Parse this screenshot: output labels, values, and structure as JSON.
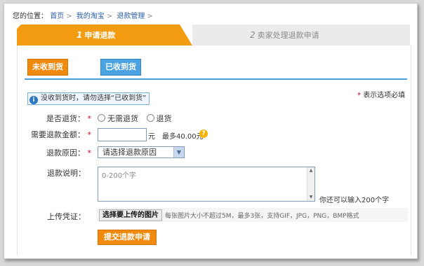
{
  "breadcrumb": {
    "prefix": "您的位置：",
    "items": [
      "首页",
      "我的淘宝",
      "退款管理"
    ],
    "separator": ">"
  },
  "steps": [
    {
      "number": "1",
      "label": "申请退款",
      "active": true
    },
    {
      "number": "2",
      "label": "卖家处理退款申请",
      "active": false
    }
  ],
  "tabs": {
    "not_received": "未收到货",
    "received": "已收到货"
  },
  "notice": {
    "icon": "info-icon",
    "text": "没收到货时，请勿选择“已收到货”"
  },
  "required_note": {
    "mark": "*",
    "text": "表示选项必填"
  },
  "form": {
    "return_goods": {
      "label": "是否退货：",
      "required": "*",
      "options": [
        "无需退货",
        "退货"
      ]
    },
    "amount": {
      "label": "需要退款金额：",
      "required": "*",
      "value": "",
      "unit": "元",
      "max_text": "最多40.00元",
      "help_icon": "question-icon"
    },
    "reason": {
      "label": "退款原因：",
      "required": "*",
      "selected": "请选择退款原因"
    },
    "description": {
      "label": "退款说明：",
      "placeholder": "0-200个字",
      "remaining_hint": "你还可以输入200个字"
    },
    "upload": {
      "label": "上传凭证：",
      "button": "选择要上传的图片",
      "hint": "每张图片大小不超过5M，最多3张，支持GIF，JPG，PNG，BMP格式"
    },
    "submit": "提交退款申请"
  },
  "colors": {
    "accent_orange": "#f39c12",
    "accent_blue": "#4aa3e0",
    "required_red": "#d6001c",
    "link_blue": "#2a5ea8"
  }
}
